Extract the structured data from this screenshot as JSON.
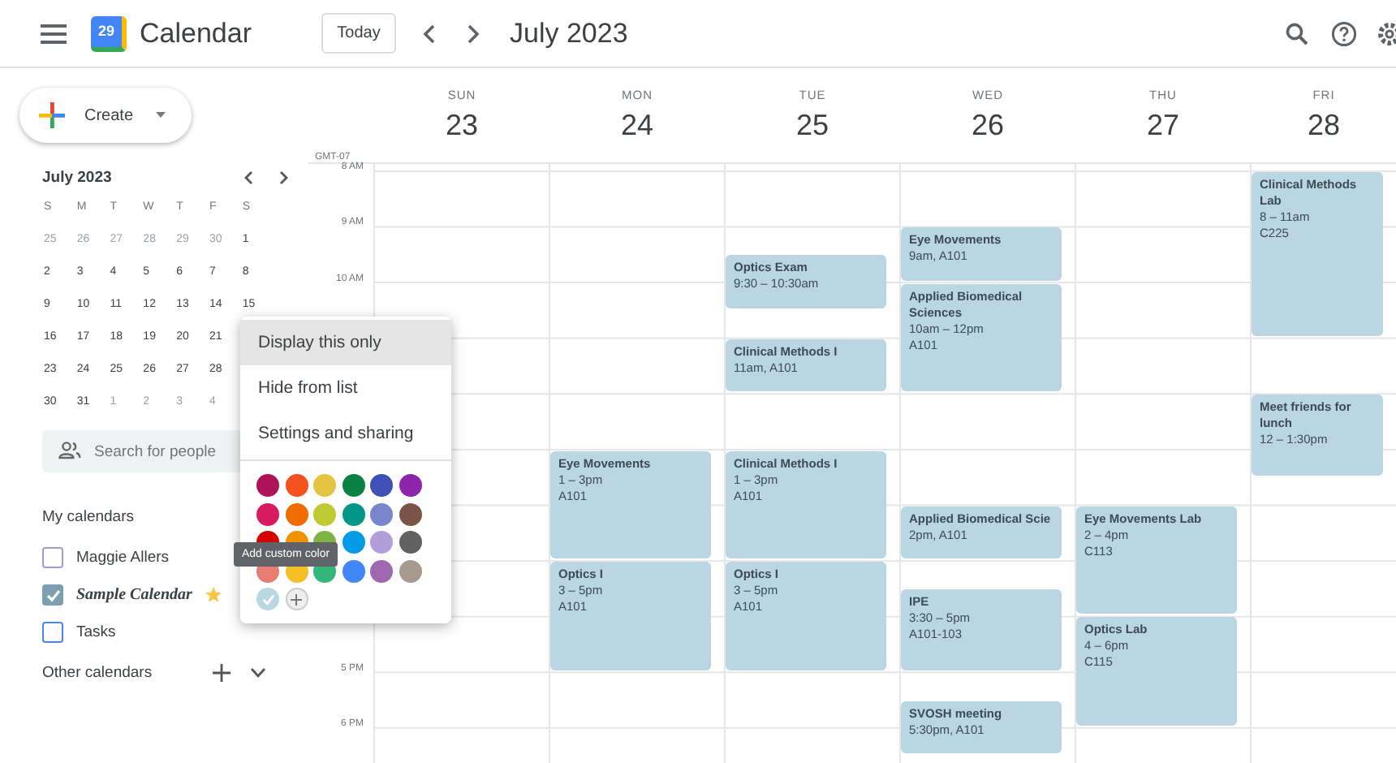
{
  "topbar": {
    "logo_text": "29",
    "app_name": "Calendar",
    "today_button": "Today",
    "title": "July 2023"
  },
  "create_button": {
    "label": "Create"
  },
  "mini_calendar": {
    "title": "July 2023",
    "weekdays": [
      "S",
      "M",
      "T",
      "W",
      "T",
      "F",
      "S"
    ],
    "weeks": [
      [
        {
          "day": "25",
          "outside": true
        },
        {
          "day": "26",
          "outside": true
        },
        {
          "day": "27",
          "outside": true
        },
        {
          "day": "28",
          "outside": true
        },
        {
          "day": "29",
          "outside": true
        },
        {
          "day": "30",
          "outside": true
        },
        {
          "day": "1",
          "outside": false
        }
      ],
      [
        {
          "day": "2",
          "outside": false
        },
        {
          "day": "3",
          "outside": false
        },
        {
          "day": "4",
          "outside": false
        },
        {
          "day": "5",
          "outside": false
        },
        {
          "day": "6",
          "outside": false
        },
        {
          "day": "7",
          "outside": false
        },
        {
          "day": "8",
          "outside": false
        }
      ],
      [
        {
          "day": "9",
          "outside": false
        },
        {
          "day": "10",
          "outside": false
        },
        {
          "day": "11",
          "outside": false
        },
        {
          "day": "12",
          "outside": false
        },
        {
          "day": "13",
          "outside": false
        },
        {
          "day": "14",
          "outside": false
        },
        {
          "day": "15",
          "outside": false
        }
      ],
      [
        {
          "day": "16",
          "outside": false
        },
        {
          "day": "17",
          "outside": false
        },
        {
          "day": "18",
          "outside": false
        },
        {
          "day": "19",
          "outside": false
        },
        {
          "day": "20",
          "outside": false
        },
        {
          "day": "21",
          "outside": false
        }
      ],
      [
        {
          "day": "23",
          "outside": false
        },
        {
          "day": "24",
          "outside": false
        },
        {
          "day": "25",
          "outside": false
        },
        {
          "day": "26",
          "outside": false
        },
        {
          "day": "27",
          "outside": false
        },
        {
          "day": "28",
          "outside": false
        }
      ],
      [
        {
          "day": "30",
          "outside": false
        },
        {
          "day": "31",
          "outside": false
        },
        {
          "day": "1",
          "outside": true
        },
        {
          "day": "2",
          "outside": true
        },
        {
          "day": "3",
          "outside": true
        },
        {
          "day": "4",
          "outside": true
        }
      ]
    ]
  },
  "people_search": {
    "placeholder": "Search for people"
  },
  "my_calendars": {
    "title": "My calendars",
    "items": [
      {
        "name": "Maggie Allers",
        "checked": false,
        "color": "#a99ad6",
        "kind": "plain"
      },
      {
        "name": "Sample Calendar",
        "checked": true,
        "color": "#7d9fb0",
        "kind": "starred"
      },
      {
        "name": "Tasks",
        "checked": false,
        "color": "#4a86e8",
        "kind": "plain"
      }
    ]
  },
  "other_calendars": {
    "title": "Other calendars"
  },
  "week": {
    "timezone": "GMT-07",
    "time_labels": [
      "8 AM",
      "9 AM",
      "10 AM",
      "5 PM",
      "6 PM"
    ],
    "days": [
      {
        "name": "SUN",
        "date": "23"
      },
      {
        "name": "MON",
        "date": "24",
        "events": [
          {
            "title": "Eye Movements",
            "lines": [
              "1 – 3pm",
              "A101"
            ]
          },
          {
            "title": "Optics I",
            "lines": [
              "3 – 5pm",
              "A101"
            ]
          }
        ]
      },
      {
        "name": "TUE",
        "date": "25",
        "events": [
          {
            "title": "Optics Exam",
            "lines": [
              "9:30 – 10:30am"
            ]
          },
          {
            "title": "Clinical Methods I",
            "lines": [
              "11am, A101"
            ]
          },
          {
            "title": "Clinical Methods I",
            "lines": [
              "1 – 3pm",
              "A101"
            ]
          },
          {
            "title": "Optics I",
            "lines": [
              "3 – 5pm",
              "A101"
            ]
          }
        ]
      },
      {
        "name": "WED",
        "date": "26",
        "events": [
          {
            "title": "Eye Movements",
            "lines": [
              "9am, A101"
            ]
          },
          {
            "title": "Applied Biomedical Sciences",
            "lines": [
              "10am – 12pm",
              "A101"
            ]
          },
          {
            "title": "Applied Biomedical Scie",
            "lines": [
              "2pm, A101"
            ]
          },
          {
            "title": "IPE",
            "lines": [
              "3:30 – 5pm",
              "A101-103"
            ]
          },
          {
            "title": "SVOSH meeting",
            "lines": [
              "5:30pm, A101"
            ]
          }
        ]
      },
      {
        "name": "THU",
        "date": "27",
        "events": [
          {
            "title": "Eye Movements Lab",
            "lines": [
              "2 – 4pm",
              "C113"
            ]
          },
          {
            "title": "Optics Lab",
            "lines": [
              "4 – 6pm",
              "C115"
            ]
          }
        ]
      },
      {
        "name": "FRI",
        "date": "28",
        "events": [
          {
            "title": "Clinical Methods Lab",
            "lines": [
              "8 – 11am",
              "C225"
            ]
          },
          {
            "title": "Meet friends for lunch",
            "lines": [
              "12 – 1:30pm"
            ]
          }
        ]
      }
    ]
  },
  "menu": {
    "items": [
      {
        "label": "Display this only",
        "selected": true
      },
      {
        "label": "Hide from list",
        "selected": false
      },
      {
        "label": "Settings and sharing",
        "selected": false
      }
    ],
    "colors": [
      {
        "color": "#ad1457",
        "selected": false
      },
      {
        "color": "#f4511e",
        "selected": false
      },
      {
        "color": "#e4c441",
        "selected": false
      },
      {
        "color": "#0b8043",
        "selected": false
      },
      {
        "color": "#3f51b5",
        "selected": false
      },
      {
        "color": "#8e24aa",
        "selected": false
      },
      {
        "color": "#d81b60",
        "selected": false
      },
      {
        "color": "#ef6c00",
        "selected": false
      },
      {
        "color": "#c0ca33",
        "selected": false
      },
      {
        "color": "#009688",
        "selected": false
      },
      {
        "color": "#7986cb",
        "selected": false
      },
      {
        "color": "#795548",
        "selected": false
      },
      {
        "color": "#d50000",
        "selected": false
      },
      {
        "color": "#f09300",
        "selected": false
      },
      {
        "color": "#7cb342",
        "selected": false
      },
      {
        "color": "#039be5",
        "selected": false
      },
      {
        "color": "#b39ddb",
        "selected": false
      },
      {
        "color": "#616161",
        "selected": false
      },
      {
        "color": "#e67c73",
        "selected": false
      },
      {
        "color": "#f6bf26",
        "selected": false
      },
      {
        "color": "#33b679",
        "selected": false
      },
      {
        "color": "#4285f4",
        "selected": false
      },
      {
        "color": "#9e69af",
        "selected": false
      },
      {
        "color": "#a79b8e",
        "selected": false
      },
      {
        "color": "#b8d8e4",
        "selected": true
      }
    ],
    "tooltip": "Add custom color"
  }
}
